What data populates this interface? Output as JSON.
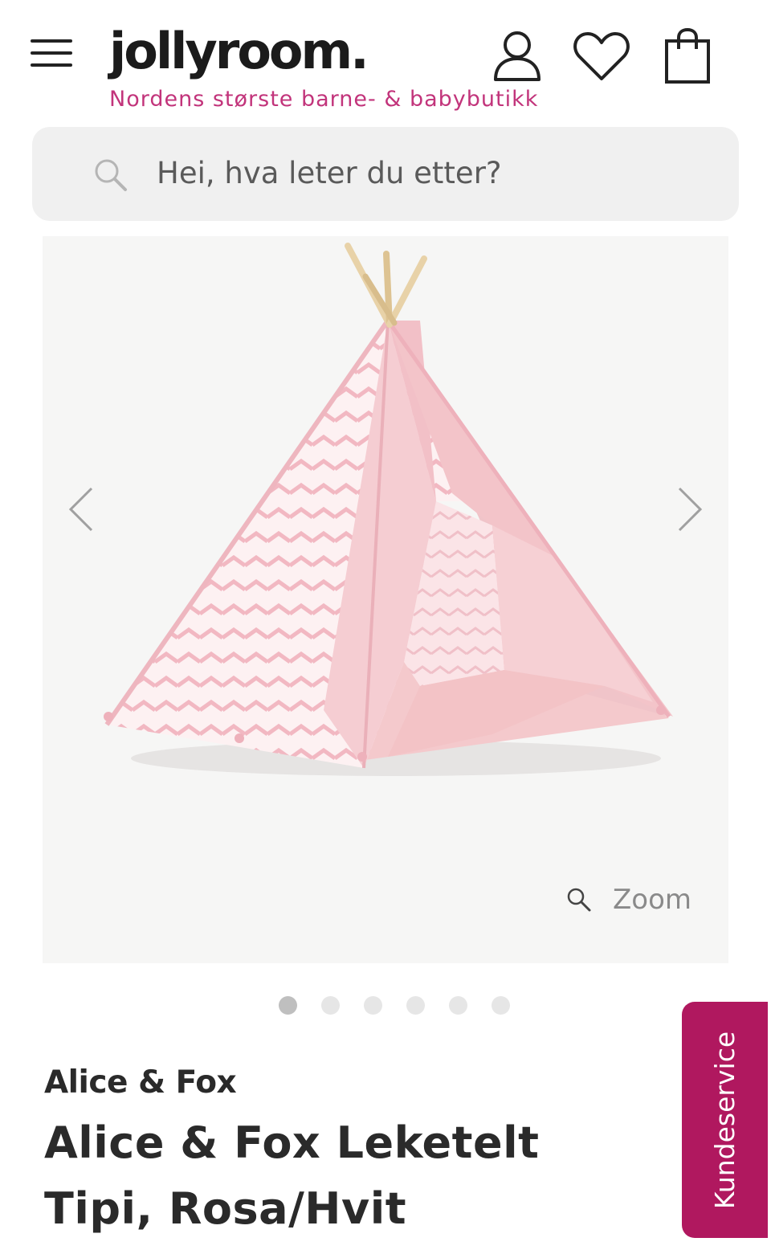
{
  "header": {
    "logo_text": "jollyroom.",
    "tagline": "Nordens største barne- & babybutikk",
    "icons": [
      "menu-icon",
      "user-icon",
      "heart-icon",
      "shopping-bag-icon"
    ]
  },
  "search": {
    "placeholder": "Hei, hva leter du etter?"
  },
  "gallery": {
    "zoom_label": "Zoom",
    "image_count": 6,
    "active_index": 0
  },
  "product": {
    "brand": "Alice & Fox",
    "title": "Alice & Fox Leketelt Tipi, Rosa/Hvit"
  },
  "support": {
    "label": "Kundeservice"
  },
  "colors": {
    "accent": "#c2347b",
    "support_tab": "#b0185f",
    "tent_pink": "#f3c6cc"
  }
}
